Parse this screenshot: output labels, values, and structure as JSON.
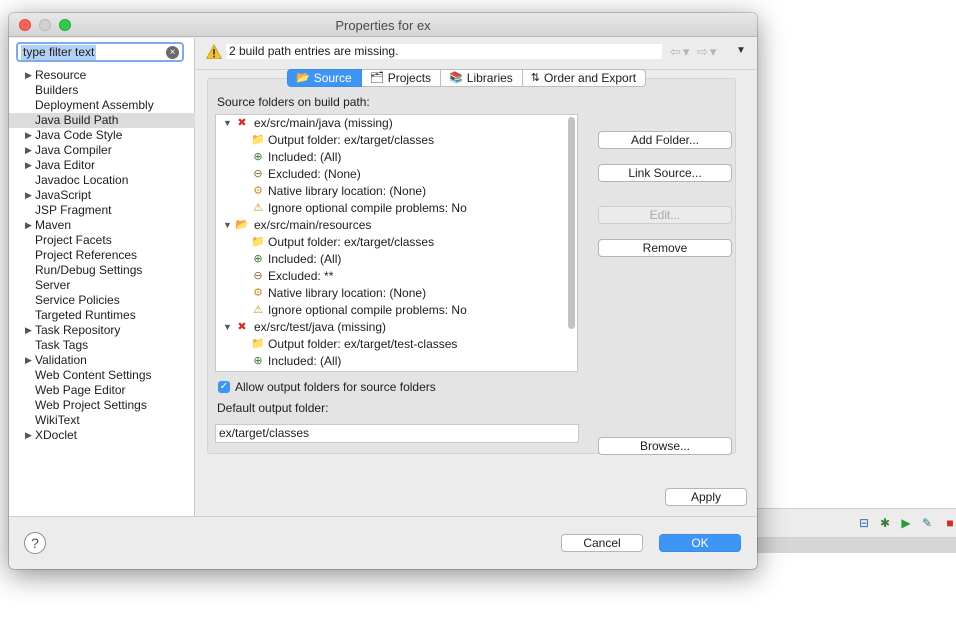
{
  "window": {
    "title": "Properties for ex"
  },
  "filter": {
    "value": "type filter text"
  },
  "nav": {
    "items": [
      {
        "label": "Resource",
        "expandable": true
      },
      {
        "label": "Builders",
        "expandable": false
      },
      {
        "label": "Deployment Assembly",
        "expandable": false
      },
      {
        "label": "Java Build Path",
        "expandable": false,
        "selected": true
      },
      {
        "label": "Java Code Style",
        "expandable": true
      },
      {
        "label": "Java Compiler",
        "expandable": true
      },
      {
        "label": "Java Editor",
        "expandable": true
      },
      {
        "label": "Javadoc Location",
        "expandable": false
      },
      {
        "label": "JavaScript",
        "expandable": true
      },
      {
        "label": "JSP Fragment",
        "expandable": false
      },
      {
        "label": "Maven",
        "expandable": true
      },
      {
        "label": "Project Facets",
        "expandable": false
      },
      {
        "label": "Project References",
        "expandable": false
      },
      {
        "label": "Run/Debug Settings",
        "expandable": false
      },
      {
        "label": "Server",
        "expandable": false
      },
      {
        "label": "Service Policies",
        "expandable": false
      },
      {
        "label": "Targeted Runtimes",
        "expandable": false
      },
      {
        "label": "Task Repository",
        "expandable": true
      },
      {
        "label": "Task Tags",
        "expandable": false
      },
      {
        "label": "Validation",
        "expandable": true
      },
      {
        "label": "Web Content Settings",
        "expandable": false
      },
      {
        "label": "Web Page Editor",
        "expandable": false
      },
      {
        "label": "Web Project Settings",
        "expandable": false
      },
      {
        "label": "WikiText",
        "expandable": false
      },
      {
        "label": "XDoclet",
        "expandable": true
      }
    ]
  },
  "status": {
    "message": "2 build path entries are missing."
  },
  "tabs": [
    {
      "label": "Source",
      "icon": "source-folder-icon",
      "active": true
    },
    {
      "label": "Projects",
      "icon": "projects-icon",
      "active": false
    },
    {
      "label": "Libraries",
      "icon": "libraries-icon",
      "active": false
    },
    {
      "label": "Order and Export",
      "icon": "order-export-icon",
      "active": false
    }
  ],
  "source": {
    "label": "Source folders on build path:",
    "tree": [
      {
        "label": "ex/src/main/java (missing)",
        "missing": true,
        "children": [
          {
            "label": "Output folder: ex/target/classes",
            "icon": "output-folder-icon"
          },
          {
            "label": "Included: (All)",
            "icon": "included-icon"
          },
          {
            "label": "Excluded: (None)",
            "icon": "excluded-icon"
          },
          {
            "label": "Native library location: (None)",
            "icon": "native-library-icon"
          },
          {
            "label": "Ignore optional compile problems: No",
            "icon": "ignore-problems-icon"
          }
        ]
      },
      {
        "label": "ex/src/main/resources",
        "missing": false,
        "children": [
          {
            "label": "Output folder: ex/target/classes",
            "icon": "output-folder-icon"
          },
          {
            "label": "Included: (All)",
            "icon": "included-icon"
          },
          {
            "label": "Excluded: **",
            "icon": "excluded-icon"
          },
          {
            "label": "Native library location: (None)",
            "icon": "native-library-icon"
          },
          {
            "label": "Ignore optional compile problems: No",
            "icon": "ignore-problems-icon"
          }
        ]
      },
      {
        "label": "ex/src/test/java (missing)",
        "missing": true,
        "children": [
          {
            "label": "Output folder: ex/target/test-classes",
            "icon": "output-folder-icon"
          },
          {
            "label": "Included: (All)",
            "icon": "included-icon"
          }
        ]
      }
    ],
    "buttons": {
      "add_folder": "Add Folder...",
      "link_source": "Link Source...",
      "edit": "Edit...",
      "remove": "Remove",
      "browse": "Browse..."
    },
    "allow_output": {
      "label": "Allow output folders for source folders",
      "checked": true
    },
    "default_output": {
      "label": "Default output folder:",
      "value": "ex/target/classes"
    }
  },
  "footer": {
    "apply": "Apply",
    "cancel": "Cancel",
    "ok": "OK",
    "help": "?"
  },
  "colors": {
    "accent": "#3e95f4",
    "missing": "#d0302a",
    "folder": "#e8b84a"
  }
}
